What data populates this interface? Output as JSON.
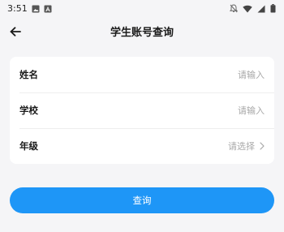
{
  "status_bar": {
    "time": "3:51",
    "icons": [
      "image-icon",
      "a-icon",
      "bell-off-icon",
      "wifi-icon",
      "signal-icon",
      "battery-icon"
    ]
  },
  "header": {
    "title": "学生账号查询",
    "back_icon": "back-arrow-icon"
  },
  "form": {
    "rows": [
      {
        "label": "姓名",
        "type": "input",
        "placeholder": "请输入",
        "value": ""
      },
      {
        "label": "学校",
        "type": "input",
        "placeholder": "请输入",
        "value": ""
      },
      {
        "label": "年级",
        "type": "select",
        "selected": "请选择",
        "icon": "chevron-right-icon"
      }
    ]
  },
  "actions": {
    "query_label": "查询"
  },
  "colors": {
    "background": "#f5f5f7",
    "card": "#ffffff",
    "accent": "#1e96f7",
    "placeholder": "#a8a8a8",
    "text": "#1a1a1a"
  }
}
